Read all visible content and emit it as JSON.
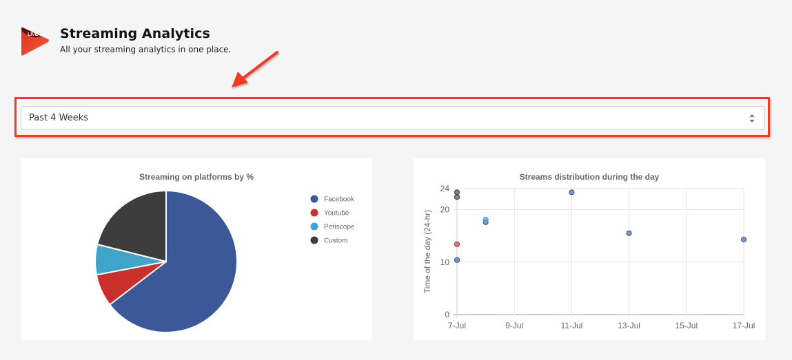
{
  "header": {
    "title": "Streaming Analytics",
    "subtitle": "All your streaming analytics in one place.",
    "logo_badge": "LIVE"
  },
  "filter": {
    "selected": "Past 4 Weeks",
    "highlight_color": "#f23b22"
  },
  "colors": {
    "Facebook": "#3b5998",
    "Youtube": "#c9302c",
    "Periscope": "#40a4c8",
    "Custom": "#3d3d3d"
  },
  "chart_data": [
    {
      "type": "pie",
      "title": "Streaming on platforms by %",
      "legend_position": "right",
      "categories": [
        "Facebook",
        "Youtube",
        "Periscope",
        "Custom"
      ],
      "values": [
        64.6,
        7.4,
        6.9,
        21.1
      ],
      "colors": [
        "#3b5998",
        "#c9302c",
        "#40a4c8",
        "#3d3d3d"
      ]
    },
    {
      "type": "scatter",
      "title": "Streams distribution during the day",
      "xlabel": "",
      "ylabel": "Time of the day (24-hr)",
      "ylim": [
        0,
        24
      ],
      "yticks": [
        0,
        10,
        20,
        24
      ],
      "xlim": [
        "7-Jul",
        "17-Jul"
      ],
      "xticks": [
        "7-Jul",
        "9-Jul",
        "11-Jul",
        "13-Jul",
        "15-Jul",
        "17-Jul"
      ],
      "grid": true,
      "series": [
        {
          "name": "Facebook",
          "color": "#3b5998",
          "points": [
            {
              "x": 7,
              "y": 10.4
            },
            {
              "x": 8,
              "y": 17.6
            },
            {
              "x": 11,
              "y": 23.3
            },
            {
              "x": 13,
              "y": 15.5
            },
            {
              "x": 17,
              "y": 14.3
            }
          ]
        },
        {
          "name": "Youtube",
          "color": "#c9302c",
          "points": [
            {
              "x": 7,
              "y": 13.4
            }
          ]
        },
        {
          "name": "Periscope",
          "color": "#40a4c8",
          "points": [
            {
              "x": 8,
              "y": 18.1
            }
          ]
        },
        {
          "name": "Custom",
          "color": "#3d3d3d",
          "points": [
            {
              "x": 7,
              "y": 23.3
            },
            {
              "x": 7,
              "y": 22.4
            }
          ]
        }
      ]
    }
  ]
}
